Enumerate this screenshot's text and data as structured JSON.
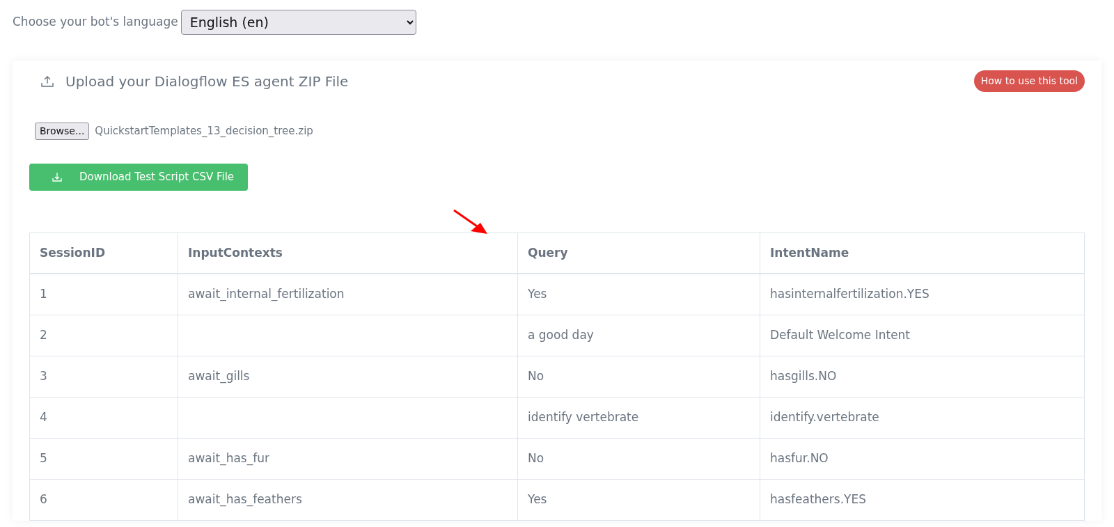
{
  "language": {
    "label": "Choose your bot's language",
    "value": "English (en)"
  },
  "upload": {
    "title": "Upload your Dialogflow ES agent ZIP File",
    "help_button": "How to use this tool",
    "browse_button": "Browse...",
    "file_name": "QuickstartTemplates_13_decision_tree.zip",
    "download_button": "Download Test Script CSV File"
  },
  "table": {
    "columns": [
      "SessionID",
      "InputContexts",
      "Query",
      "IntentName"
    ],
    "rows": [
      [
        "1",
        "await_internal_fertilization",
        "Yes",
        "hasinternalfertilization.YES"
      ],
      [
        "2",
        "",
        "a good day",
        "Default Welcome Intent"
      ],
      [
        "3",
        "await_gills",
        "No",
        "hasgills.NO"
      ],
      [
        "4",
        "",
        "identify vertebrate",
        "identify.vertebrate"
      ],
      [
        "5",
        "await_has_fur",
        "No",
        "hasfur.NO"
      ],
      [
        "6",
        "await_has_feathers",
        "Yes",
        "hasfeathers.YES"
      ]
    ]
  }
}
